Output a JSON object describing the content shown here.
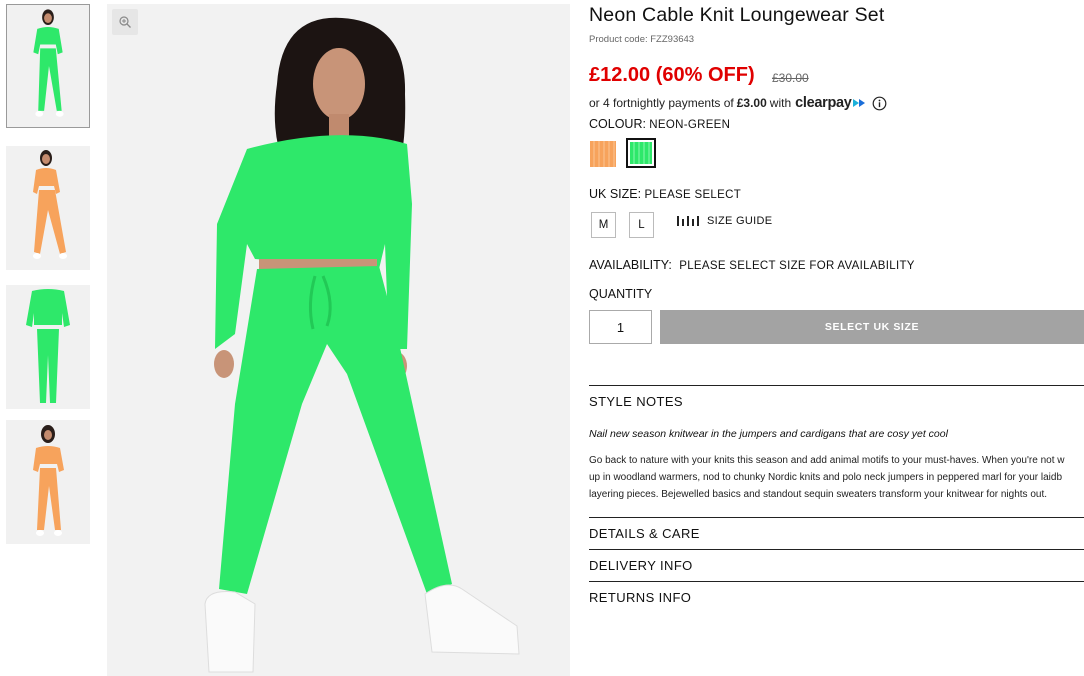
{
  "product": {
    "title": "Neon Cable Knit Loungewear Set",
    "code": "Product code: FZZ93643",
    "price": "£12.00 (60% OFF)",
    "was_price": "£30.00"
  },
  "clearpay": {
    "prefix": "or 4 fortnightly payments of",
    "amount": "£3.00",
    "with": "with",
    "brand": "clearpay"
  },
  "colour": {
    "label": "COLOUR:",
    "value": "NEON-GREEN",
    "options": [
      {
        "name": "orange",
        "color": "#f7a35c"
      },
      {
        "name": "neon-green",
        "color": "#2ee86a"
      }
    ]
  },
  "size": {
    "label": "UK SIZE:",
    "value": "PLEASE SELECT",
    "options": [
      "M",
      "L"
    ],
    "guide": "SIZE GUIDE"
  },
  "availability": {
    "label": "AVAILABILITY:",
    "value": "PLEASE SELECT SIZE FOR AVAILABILITY"
  },
  "quantity": {
    "label": "QUANTITY",
    "value": "1"
  },
  "add_button": "SELECT UK SIZE",
  "sections": {
    "style_notes": "STYLE NOTES",
    "style_italic": "Nail new season knitwear in the jumpers and cardigans that are cosy yet cool",
    "style_body": [
      "Go back to nature with your knits this season and add animal motifs to your must-haves. When you're not w",
      "up in woodland warmers, nod to chunky Nordic knits and polo neck jumpers in peppered marl for your laidb",
      "layering pieces. Bejewelled basics and standout sequin sweaters transform your knitwear for nights out."
    ],
    "details": "DETAILS & CARE",
    "delivery": "DELIVERY INFO",
    "returns": "RETURNS INFO"
  },
  "colors": {
    "price_red": "#e00000",
    "neon_green": "#2ee86a",
    "orange": "#f7a35c",
    "button_grey": "#a3a3a3"
  },
  "icons": {
    "zoom": "zoom-in-icon",
    "info": "info-icon",
    "size_guide": "ruler-icon"
  }
}
